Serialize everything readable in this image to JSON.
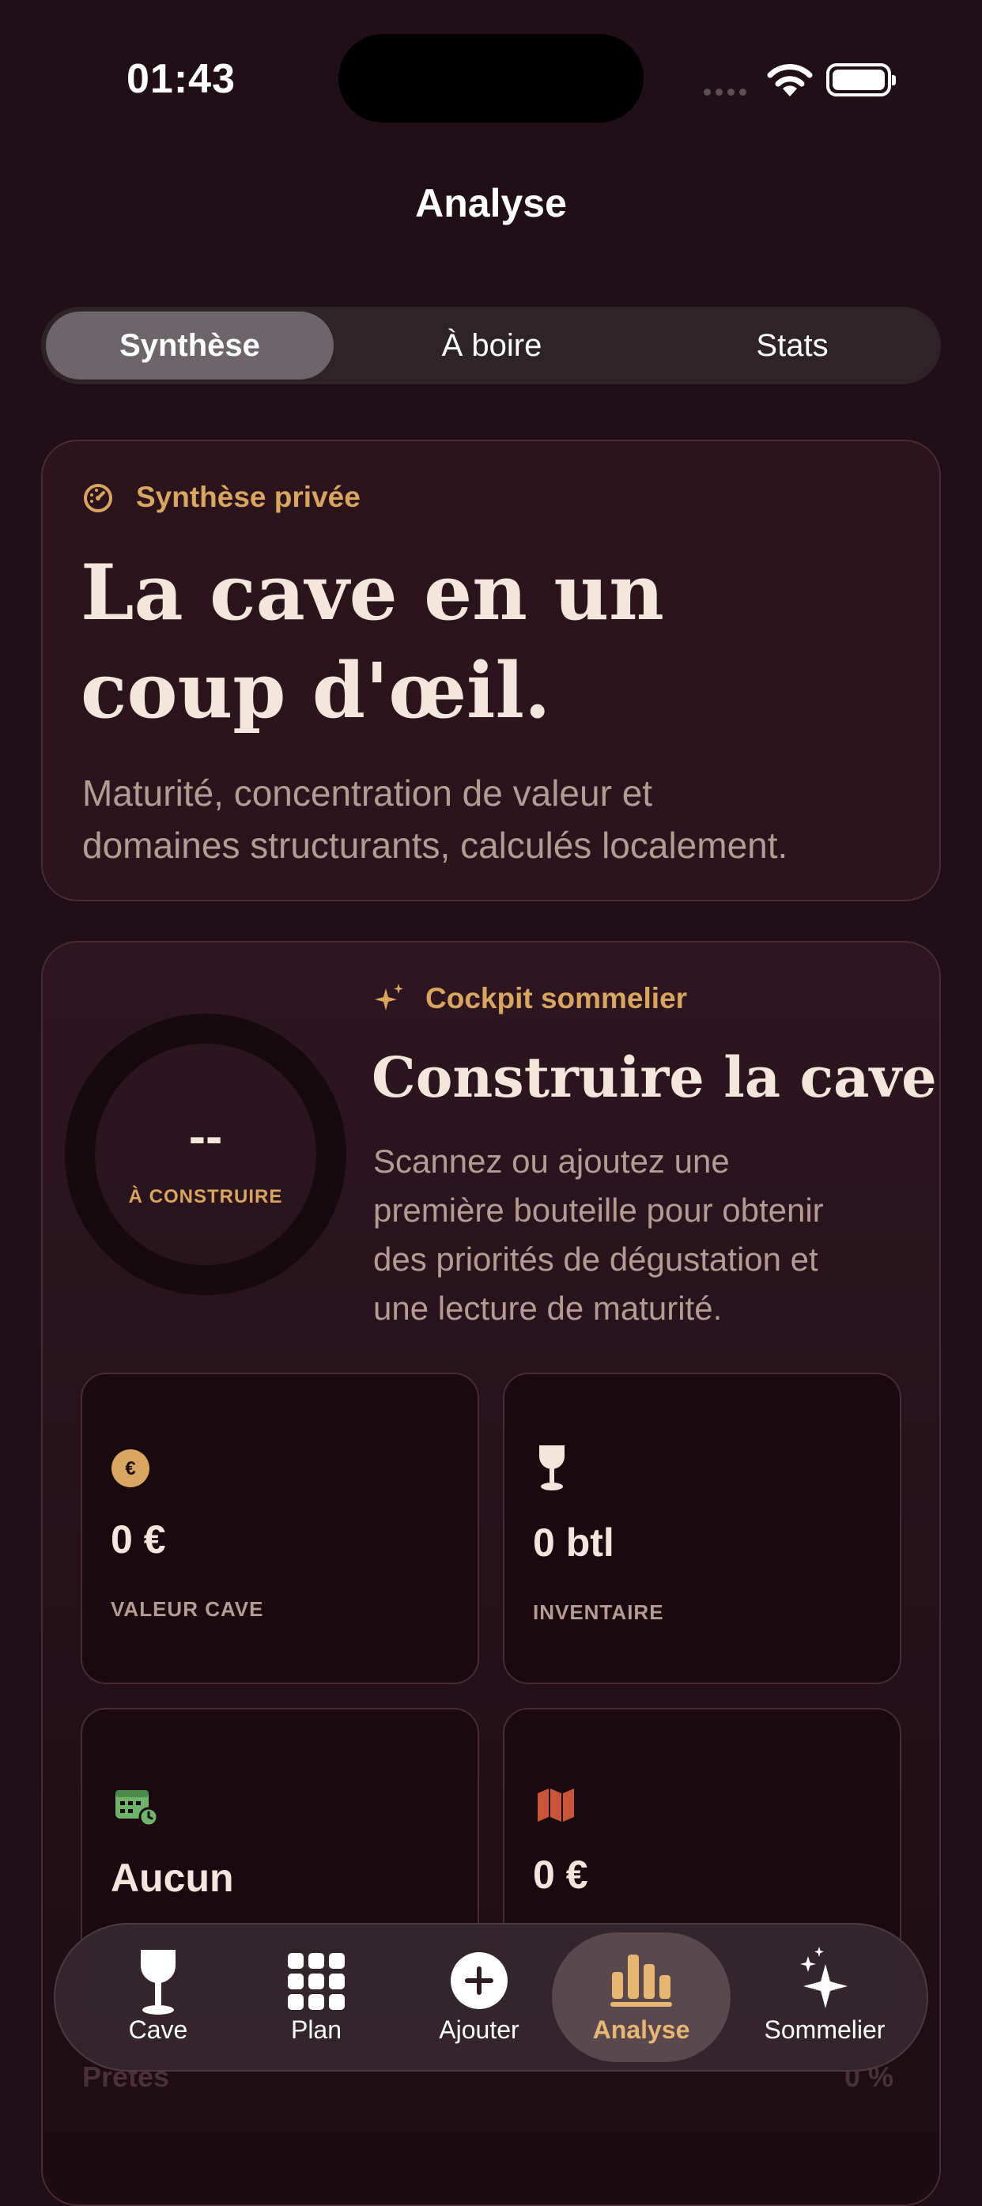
{
  "status_bar": {
    "time": "01:43"
  },
  "header": {
    "title": "Analyse"
  },
  "segments": [
    {
      "label": "Synthèse",
      "active": true
    },
    {
      "label": "À boire",
      "active": false
    },
    {
      "label": "Stats",
      "active": false
    }
  ],
  "intro_card": {
    "eyebrow": "Synthèse privée",
    "title_line1": "La cave en un",
    "title_line2": "coup d'œil.",
    "desc_line1": "Maturité, concentration de valeur et",
    "desc_line2": "domaines structurants, calculés localement."
  },
  "cockpit": {
    "eyebrow": "Cockpit sommelier",
    "title": "Construire la cave",
    "ring_value": "--",
    "ring_label": "À CONSTRUIRE",
    "desc_lines": [
      "Scannez ou ajoutez une",
      "première bouteille pour obtenir",
      "des priorités de dégustation et",
      "une lecture de maturité."
    ]
  },
  "tiles": [
    {
      "icon": "euro-icon",
      "value": "0 €",
      "label": "VALEUR CAVE"
    },
    {
      "icon": "wine-glass-icon",
      "value": "0 btl",
      "label": "INVENTAIRE"
    },
    {
      "icon": "calendar-icon",
      "value": "Aucun",
      "label": ""
    },
    {
      "icon": "map-icon",
      "value": "0 €",
      "label": ""
    }
  ],
  "peek": {
    "left": "Prêtes",
    "right": "0 %"
  },
  "tabbar": [
    {
      "label": "Cave",
      "icon": "wine-glass-icon",
      "active": false
    },
    {
      "label": "Plan",
      "icon": "grid-icon",
      "active": false
    },
    {
      "label": "Ajouter",
      "icon": "plus-circle-icon",
      "active": false
    },
    {
      "label": "Analyse",
      "icon": "bar-chart-icon",
      "active": true
    },
    {
      "label": "Sommelier",
      "icon": "sparkles-icon",
      "active": false
    }
  ],
  "colors": {
    "accent": "#d9a661",
    "background": "#200f16",
    "card": "#2b141c",
    "calendar_green": "#6fb36a",
    "map_orange": "#c8553a"
  }
}
